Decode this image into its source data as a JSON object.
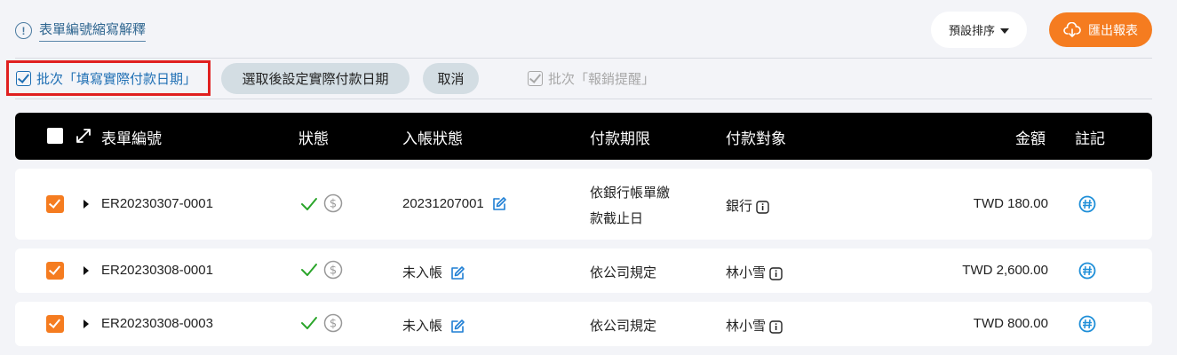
{
  "header": {
    "legend_link": "表單編號縮寫解釋",
    "sort_label": "預設排序",
    "export_label": "匯出報表"
  },
  "toolbar": {
    "batch_fill_date": "批次「填寫實際付款日期」",
    "set_date_after_select": "選取後設定實際付款日期",
    "cancel": "取消",
    "batch_remind": "批次「報銷提醒」"
  },
  "table": {
    "columns": {
      "form_no": "表單編號",
      "status": "狀態",
      "posting_status": "入帳狀態",
      "payment_deadline": "付款期限",
      "payee": "付款對象",
      "amount": "金額",
      "note": "註記"
    },
    "rows": [
      {
        "form_no": "ER20230307-0001",
        "posting": "20231207001",
        "deadline_line1": "依銀行帳單繳",
        "deadline_line2": "款截止日",
        "payee": "銀行",
        "amount": "TWD 180.00"
      },
      {
        "form_no": "ER20230308-0001",
        "posting": "未入帳",
        "deadline_line1": "依公司規定",
        "deadline_line2": "",
        "payee": "林小雪",
        "amount": "TWD 2,600.00"
      },
      {
        "form_no": "ER20230308-0003",
        "posting": "未入帳",
        "deadline_line1": "依公司規定",
        "deadline_line2": "",
        "payee": "林小雪",
        "amount": "TWD 800.00"
      }
    ]
  },
  "colors": {
    "accent_orange": "#f57c20",
    "link_blue": "#1f6fb4",
    "highlight_red": "#e02020",
    "ok_green": "#2aa52a",
    "header_bg": "#000000"
  }
}
